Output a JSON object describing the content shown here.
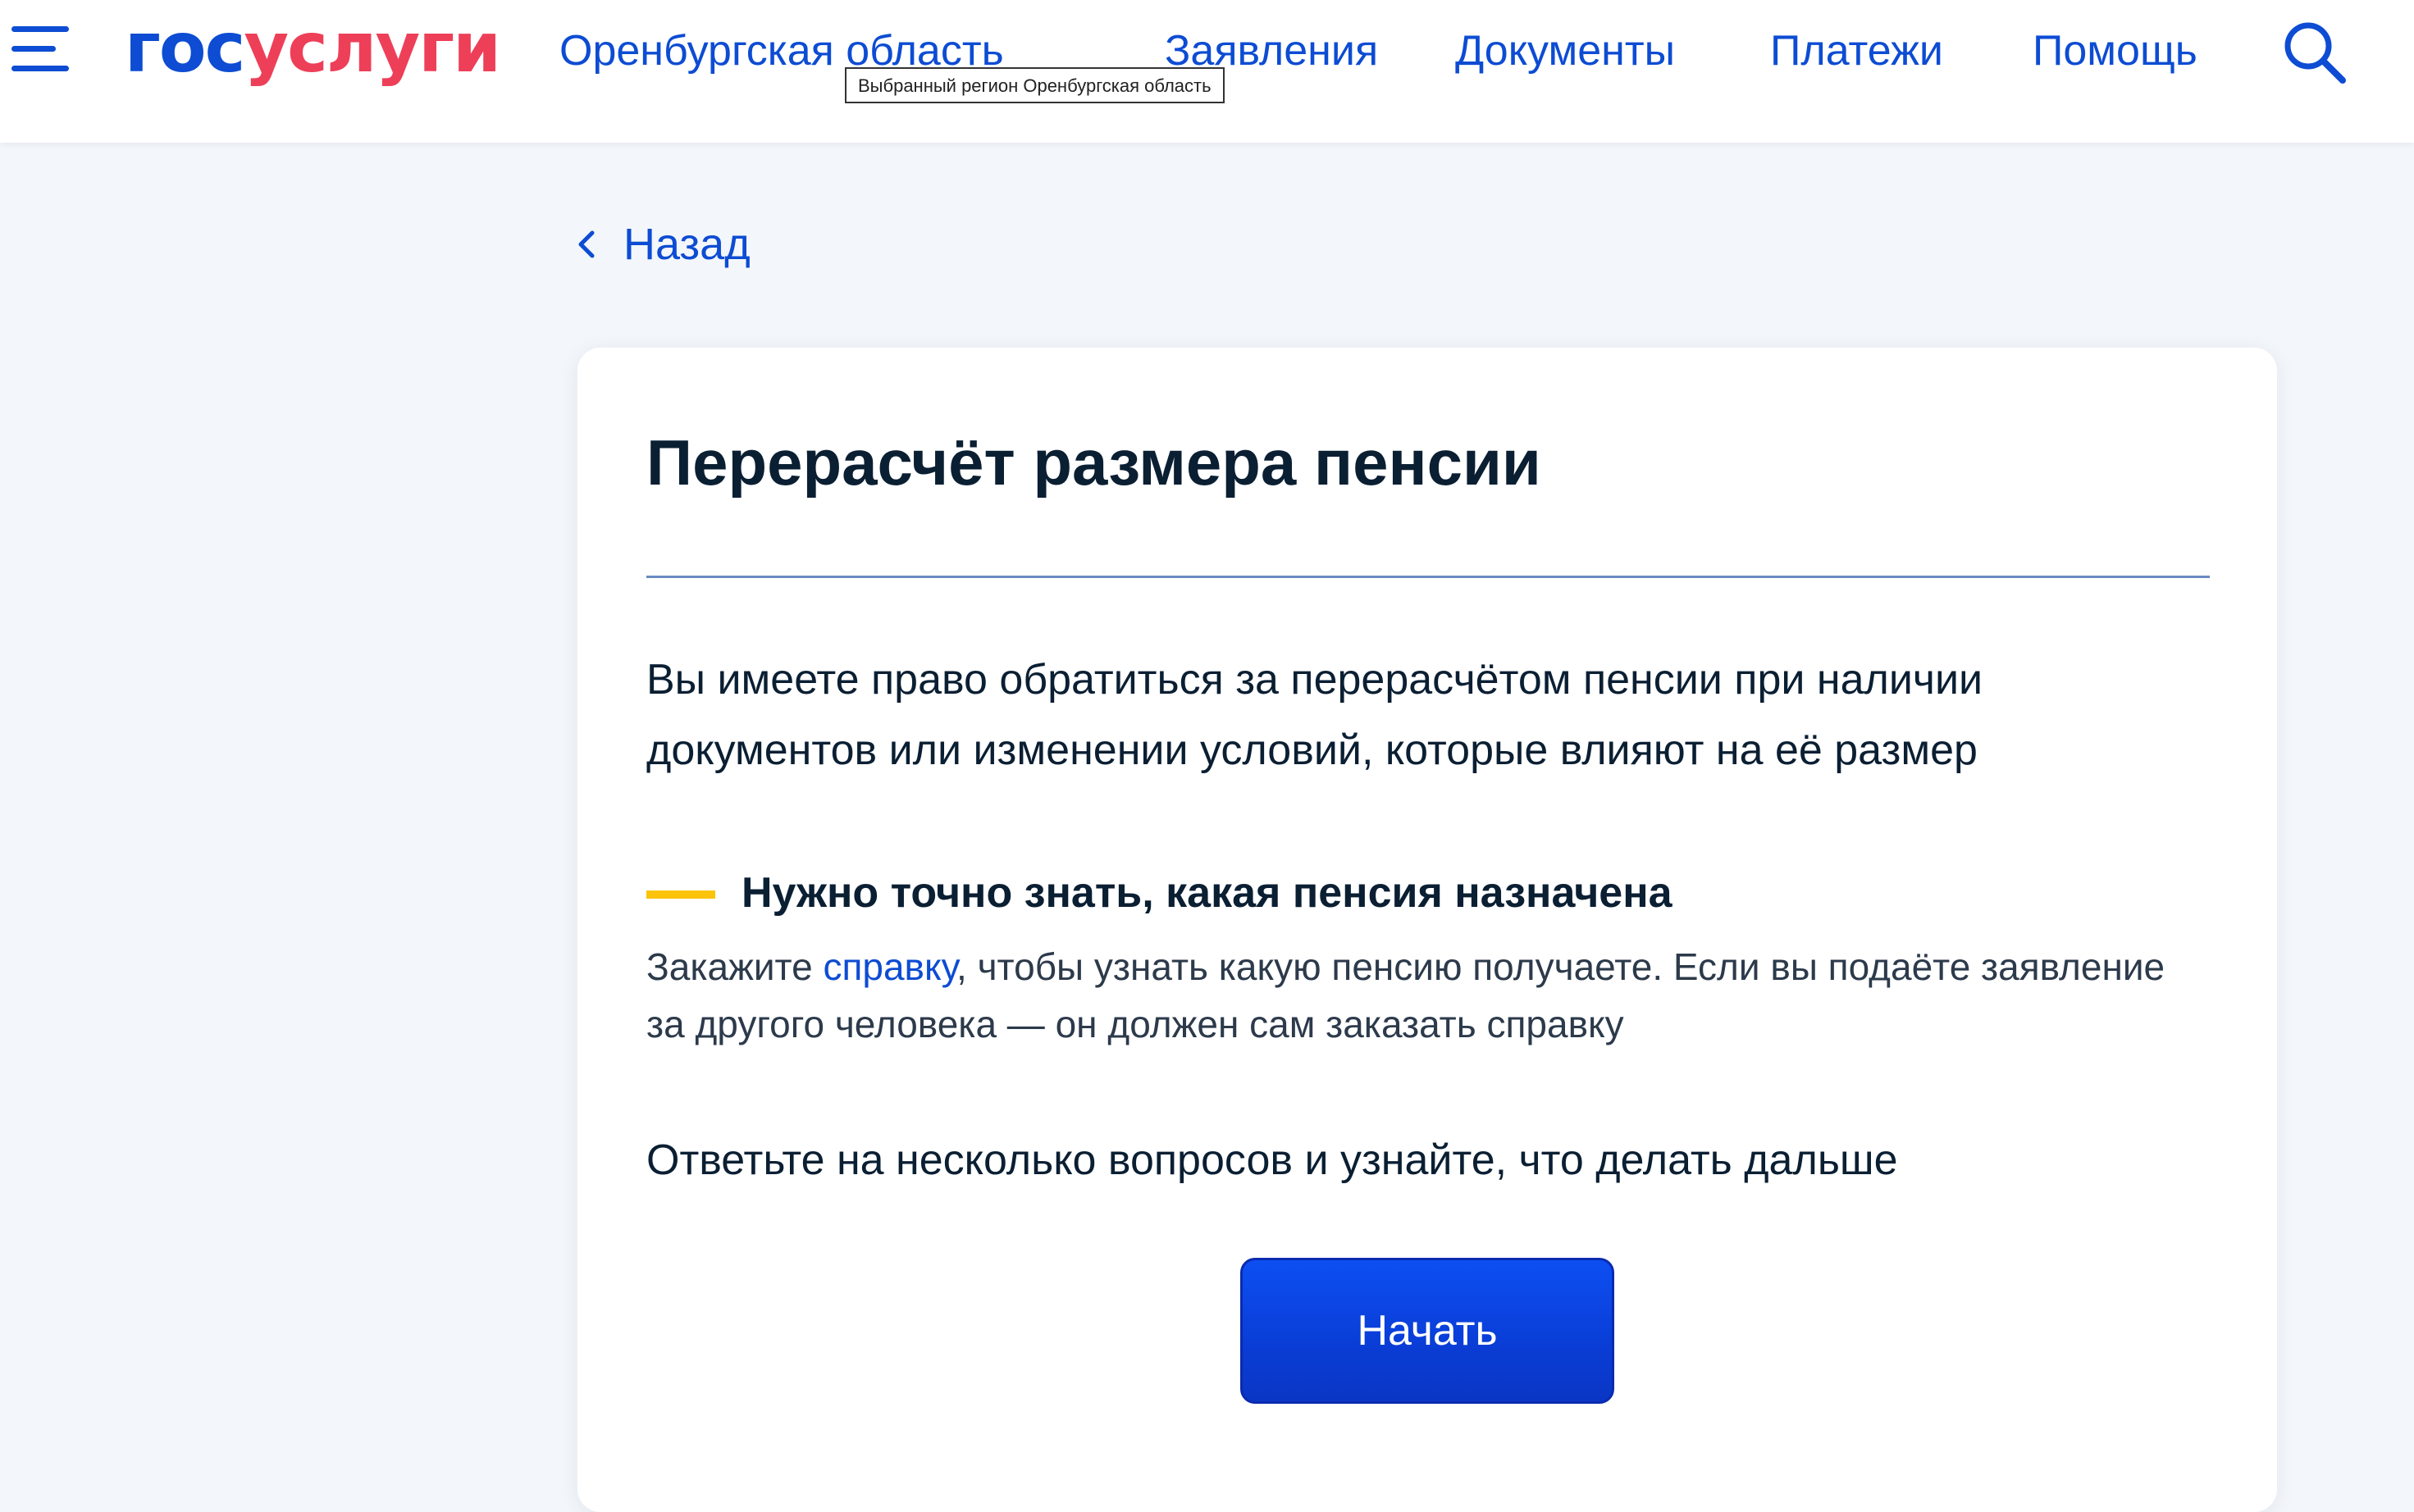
{
  "header": {
    "logo": {
      "part1": "гос",
      "part2": "услуги",
      "color_part1": "#0d4cd3",
      "color_part2": "#ee3f58"
    },
    "menu_icon": "hamburger-menu-icon",
    "region_link": "Оренбургская область",
    "region_tooltip": "Выбранный регион Оренбургская область",
    "nav": {
      "applications": "Заявления",
      "documents": "Документы",
      "payments": "Платежи",
      "help": "Помощь"
    },
    "search_icon": "search-icon"
  },
  "back": {
    "label": "Назад",
    "icon": "chevron-left-icon"
  },
  "card": {
    "title": "Перерасчёт размера пенсии",
    "intro": "Вы имеете право обратиться за перерасчётом пенсии при наличии документов или изменении условий, которые влияют на её размер",
    "notice": {
      "title": "Нужно точно знать, какая пенсия назначена",
      "text_before": "Закажите ",
      "link": "справку",
      "text_after": ", чтобы узнать какую пенсию получаете. Если вы подаёте заявление за другого человека — он должен сам заказать справку",
      "accent_color": "#fcc30b"
    },
    "prompt": "Ответьте на несколько вопросов и узнайте, что делать дальше",
    "start_button": "Начать"
  },
  "colors": {
    "primary": "#0d4cd3",
    "text": "#0b1f33",
    "background": "#f3f6fa"
  }
}
